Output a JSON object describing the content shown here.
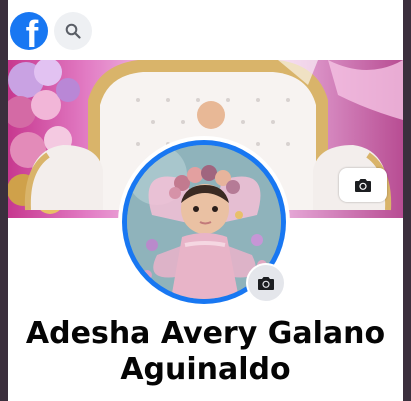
{
  "profile": {
    "name_line1": "Adesha Avery Galano",
    "name_line2": "Aguinaldo"
  },
  "icons": {
    "logo": "facebook-logo-icon",
    "search": "search-icon",
    "cover_camera": "camera-icon",
    "avatar_camera": "camera-icon"
  },
  "colors": {
    "brand": "#1877f2",
    "button_bg": "#e4e6eb",
    "text": "#050505"
  }
}
